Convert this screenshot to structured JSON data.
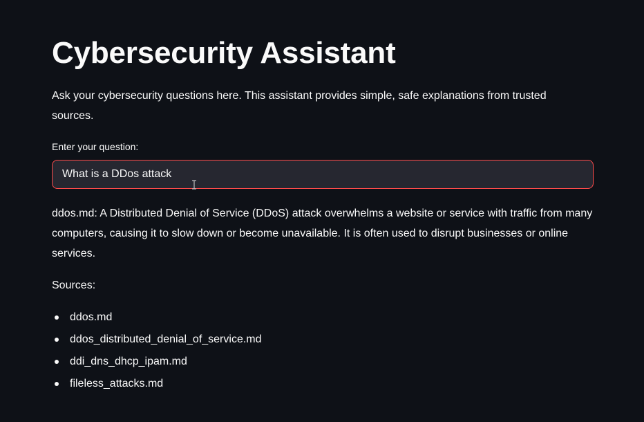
{
  "header": {
    "title": "Cybersecurity Assistant"
  },
  "intro": "Ask your cybersecurity questions here. This assistant provides simple, safe explanations from trusted sources.",
  "question_input": {
    "label": "Enter your question:",
    "value": "What is a DDos attack"
  },
  "answer": "ddos.md: A Distributed Denial of Service (DDoS) attack overwhelms a website or service with traffic from many computers, causing it to slow down or become unavailable. It is often used to disrupt businesses or online services.",
  "sources": {
    "label": "Sources:",
    "items": [
      "ddos.md",
      "ddos_distributed_denial_of_service.md",
      "ddi_dns_dhcp_ipam.md",
      "fileless_attacks.md"
    ]
  },
  "colors": {
    "background": "#0e1117",
    "text": "#fafafa",
    "input_background": "#262730",
    "input_focus_border": "#ff4b4b"
  }
}
